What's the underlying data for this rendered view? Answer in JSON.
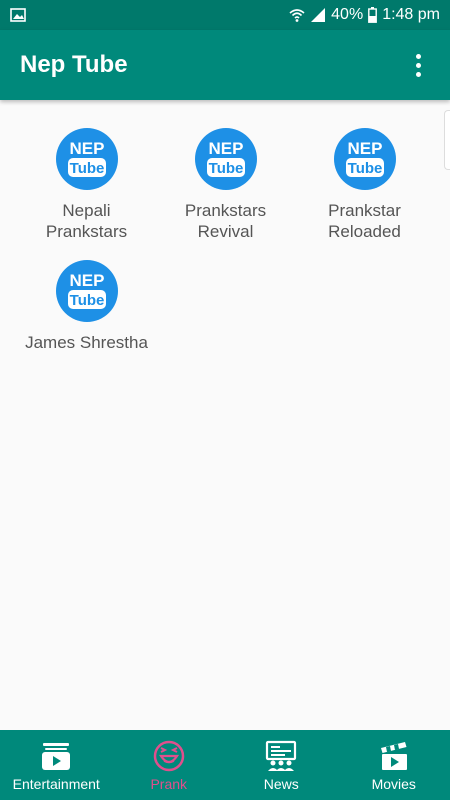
{
  "status_bar": {
    "battery": "40%",
    "time": "1:48 pm",
    "icons": [
      "gallery-icon",
      "wifi-icon",
      "signal-icon",
      "battery-icon"
    ]
  },
  "app_bar": {
    "title": "Nep Tube",
    "menu_icon": "more-vert-icon"
  },
  "channels": [
    {
      "label": "Nepali\nPrankstars",
      "logo_top": "NEP",
      "logo_bottom": "Tube"
    },
    {
      "label": "Prankstars\nRevival",
      "logo_top": "NEP",
      "logo_bottom": "Tube"
    },
    {
      "label": "Prankstar\nReloaded",
      "logo_top": "NEP",
      "logo_bottom": "Tube"
    },
    {
      "label": "James Shrestha",
      "logo_top": "NEP",
      "logo_bottom": "Tube"
    }
  ],
  "bottom_nav": {
    "items": [
      {
        "label": "Entertainment",
        "icon": "tv-play-icon",
        "active": false
      },
      {
        "label": "Prank",
        "icon": "laughing-face-icon",
        "active": true
      },
      {
        "label": "News",
        "icon": "news-broadcast-icon",
        "active": false
      },
      {
        "label": "Movies",
        "icon": "clapperboard-icon",
        "active": false
      }
    ]
  },
  "colors": {
    "status_bar": "#00796b",
    "app_bar": "#00897b",
    "active_tab": "#e04f8d",
    "logo_blue": "#1e90e6"
  }
}
